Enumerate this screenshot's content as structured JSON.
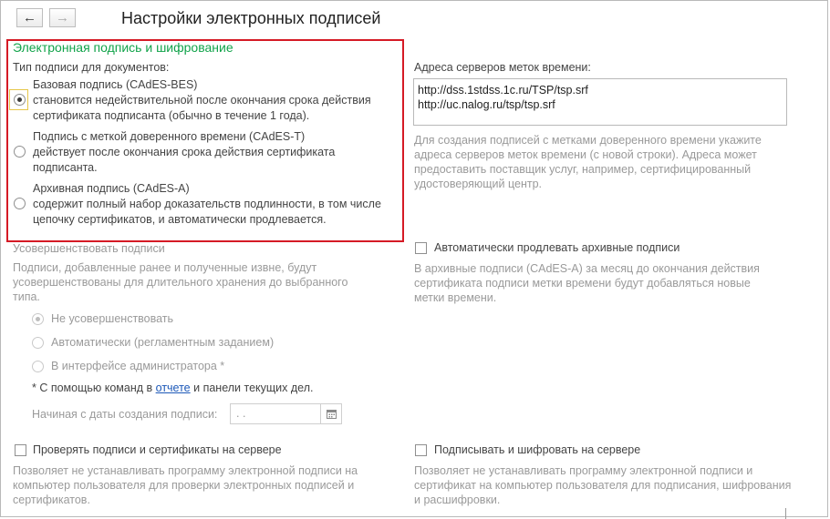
{
  "window": {
    "title": "Настройки электронных подписей",
    "back_icon": "←",
    "forward_icon": "→"
  },
  "signature_section": {
    "heading": "Электронная подпись и шифрование",
    "type_label": "Тип подписи для документов:",
    "options": [
      {
        "title": "Базовая подпись (CAdES-BES)",
        "desc1": "становится недействительной после окончания срока действия",
        "desc2": "сертификата подписанта (обычно в течение 1 года).",
        "selected": true
      },
      {
        "title": "Подпись с меткой доверенного времени (CAdES-T)",
        "desc1": "действует после окончания срока действия сертификата",
        "desc2": "подписанта.",
        "selected": false
      },
      {
        "title": "Архивная подпись (CAdES-A)",
        "desc1": "содержит полный набор доказательств подлинности, в том числе",
        "desc2": "цепочку сертификатов, и автоматически продлевается.",
        "selected": false
      }
    ]
  },
  "timestamp": {
    "label": "Адреса серверов меток времени:",
    "servers": [
      "http://dss.1stdss.1c.ru/TSP/tsp.srf",
      "http://uc.nalog.ru/tsp/tsp.srf"
    ],
    "hint": [
      "Для создания подписей с метками доверенного времени укажите",
      "адреса серверов меток времени (с новой строки). Адреса может",
      "предоставить поставщик услуг, например, сертифицированный",
      "удостоверяющий центр."
    ]
  },
  "enhance": {
    "heading": "Усовершенствовать подписи",
    "desc": [
      "Подписи, добавленные ранее и полученные извне, будут",
      "усовершенствованы для длительного хранения до выбранного",
      "типа."
    ],
    "options": [
      {
        "label": "Не усовершенствовать",
        "selected": true
      },
      {
        "label": "Автоматически (регламентным заданием)",
        "selected": false
      },
      {
        "label": "В интерфейсе администратора *",
        "selected": false
      }
    ],
    "footnote_prefix": "* С помощью команд в ",
    "footnote_link": "отчете",
    "footnote_suffix": " и панели текущих дел.",
    "date_label": "Начиная с даты создания подписи:",
    "date_value": ".   ."
  },
  "auto_extend": {
    "label": "Автоматически продлевать архивные подписи",
    "desc": [
      "В архивные подписи (CAdES-A) за месяц до окончания действия",
      "сертификата подписи метки времени будут добавляться новые",
      "метки времени."
    ]
  },
  "verify_server": {
    "label": "Проверять подписи и сертификаты на сервере",
    "desc": [
      "Позволяет не устанавливать программу электронной подписи на",
      "компьютер пользователя для проверки электронных подписей и",
      "сертификатов."
    ]
  },
  "sign_server": {
    "label": "Подписывать и шифровать на сервере",
    "desc": [
      "Позволяет не устанавливать программу электронной подписи и",
      "сертификат на компьютер пользователя для подписания, шифрования",
      "и расшифровки."
    ]
  }
}
